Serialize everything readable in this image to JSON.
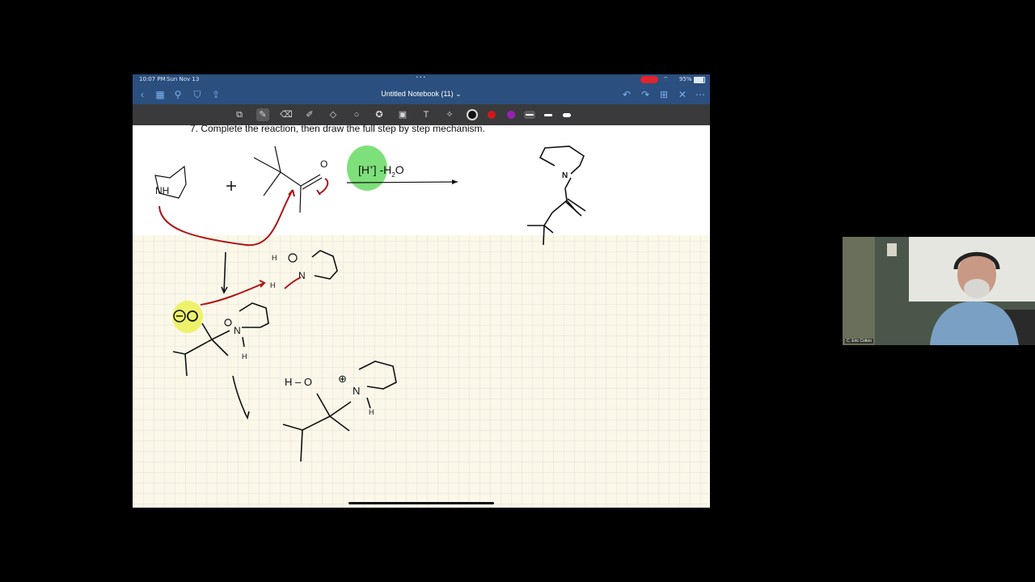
{
  "status_bar": {
    "time": "10:07 PM",
    "date": "Sun Nov 13",
    "battery": "95%"
  },
  "nav_bar": {
    "title": "Untitled Notebook (11) ⌄",
    "icons": [
      "chevron-left-icon",
      "grid-icon",
      "search-icon",
      "bookmark-icon",
      "share-icon",
      "undo-icon",
      "redo-icon",
      "add-page-icon",
      "close-icon",
      "more-icon"
    ]
  },
  "toolbar": {
    "tools": [
      "image-icon",
      "pen-icon",
      "eraser-icon",
      "highlighter-icon",
      "shapes-icon",
      "lasso-icon",
      "star-icon",
      "photo-icon",
      "text-icon",
      "laser-pointer-icon"
    ],
    "selected_tool": "pen-icon",
    "colors": [
      "#111111",
      "#d01818",
      "#9b1fb5"
    ],
    "selected_stroke": "thin"
  },
  "document": {
    "question": "7.  Complete the reaction, then draw the full step by step mechanism.",
    "reactant_label": "NH",
    "plus": "+",
    "carbonyl_oxygen": "O",
    "reagent": {
      "prefix": "[H",
      "charge": "+",
      "middle": "] -H",
      "subscript": "2",
      "suffix": "O"
    },
    "colors": {
      "highlight_green": "#7ee07a",
      "highlight_yellow": "#eef26a",
      "arrow_red": "#b01414",
      "grid_paper": "#fbf8ea",
      "grid_line": "#dcdcd2"
    }
  },
  "webcam": {
    "participant_name": "C. Eric Cotton"
  }
}
